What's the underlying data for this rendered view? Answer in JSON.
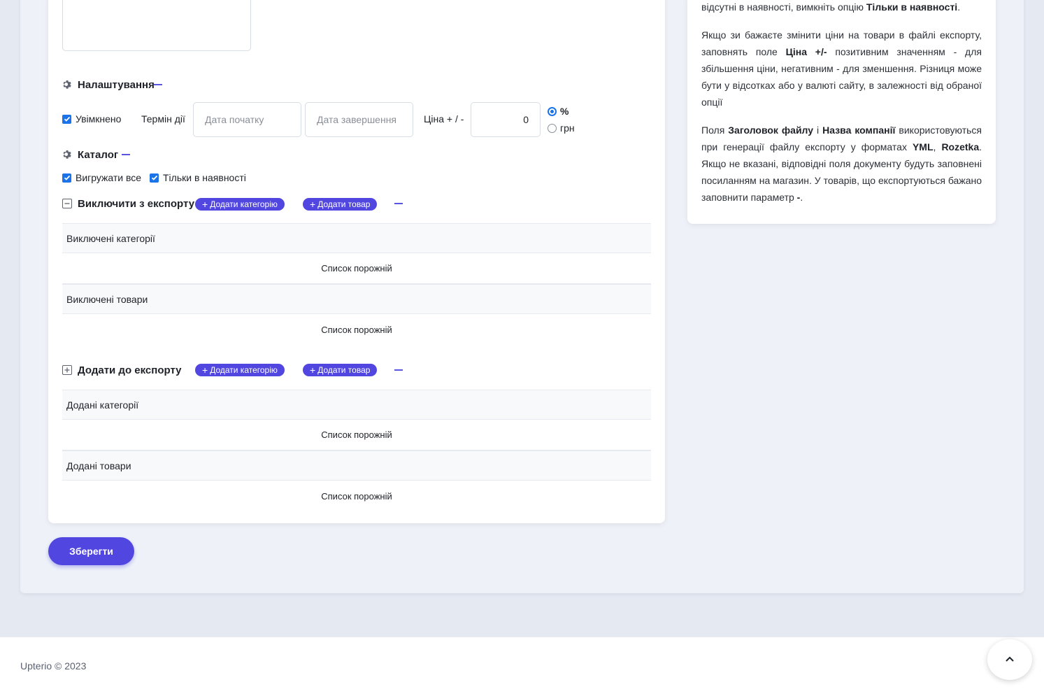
{
  "help": {
    "p1_text": "відсутні в наявності, вимкніть опцію ",
    "p1_bold": "Тільки в наявності",
    "p1_end": ".",
    "p2_a": "Якщо зи бажаєте змінити ціни на товари в файлі експорту, заповнять поле ",
    "p2_bold": "Ціна +/-",
    "p2_b": " позитивним значенням - для збільшення ціни, негативним - для зменшення. Різниця може бути у відсотках або у валюті сайту, в залежності від обраної опції",
    "p3_a": "Поля ",
    "p3_bold1": "Заголовок файлу",
    "p3_b": " і ",
    "p3_bold2": "Назва компанії",
    "p3_c": " використовуються при генерації файлу експорту у форматах ",
    "p3_bold3": "YML",
    "p3_d": ", ",
    "p3_bold4": "Rozetka",
    "p3_e": ". Якщо не вказані, відповідні поля документу будуть заповнені посиланням на магазин. У товарів, що експортуються бажано заповнити параметр ",
    "p3_bold5": "-",
    "p3_f": "."
  },
  "settings": {
    "title": "Налаштування",
    "enabled_label": "Увімкнено",
    "term_label": "Термін дії",
    "start_placeholder": "Дата початку",
    "end_placeholder": "Дата завершення",
    "price_label": "Ціна + / -",
    "price_value": "0",
    "unit_percent": "%",
    "unit_currency": "грн"
  },
  "catalog": {
    "title": "Каталог",
    "export_all_label": "Вигружати все",
    "in_stock_label": "Тільки в наявності"
  },
  "exclude": {
    "title": "Виключити з експорту",
    "add_category": "Додати категорію",
    "add_product": "Додати товар",
    "categories_header": "Виключені категорії",
    "categories_empty": "Список порожній",
    "products_header": "Виключені товари",
    "products_empty": "Список порожній"
  },
  "include": {
    "title": "Додати до експорту",
    "add_category": "Додати категорію",
    "add_product": "Додати товар",
    "categories_header": "Додані категорії",
    "categories_empty": "Список порожній",
    "products_header": "Додані товари",
    "products_empty": "Список порожній"
  },
  "save_label": "Зберегти",
  "footer": {
    "text": "Upterio © 2023"
  },
  "colors": {
    "accent": "#5146e0",
    "checkbox": "#1a73e8",
    "background": "#e4e9f2"
  }
}
